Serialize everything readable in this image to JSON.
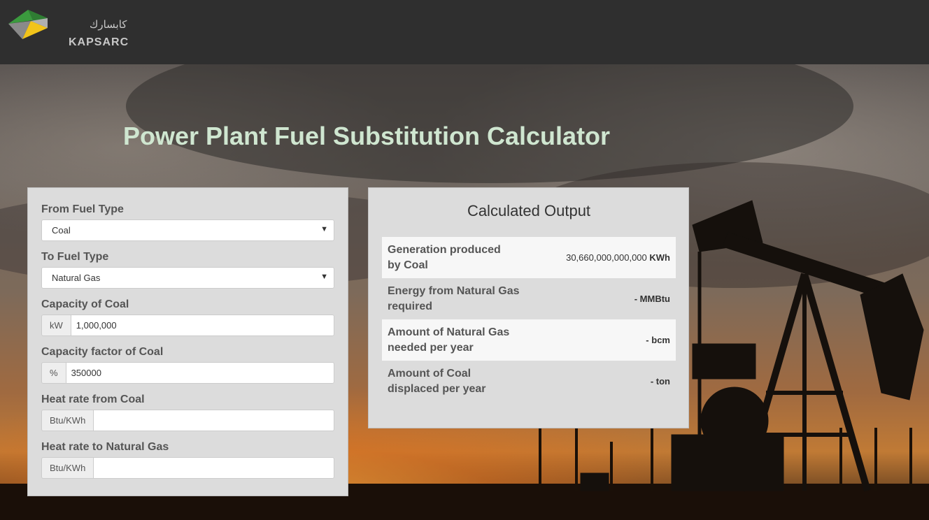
{
  "header": {
    "logo_ar": "كابسارك",
    "logo_en": "KAPSARC"
  },
  "page": {
    "title": "Power Plant Fuel Substitution Calculator"
  },
  "inputs": {
    "from_fuel": {
      "label": "From Fuel Type",
      "value": "Coal"
    },
    "to_fuel": {
      "label": "To Fuel Type",
      "value": "Natural Gas"
    },
    "capacity": {
      "label": "Capacity of Coal",
      "unit": "kW",
      "value": "1,000,000"
    },
    "capacity_factor": {
      "label": "Capacity factor of Coal",
      "unit": "%",
      "value": "350000"
    },
    "heat_rate_from": {
      "label": "Heat rate from Coal",
      "unit": "Btu/KWh",
      "value": ""
    },
    "heat_rate_to": {
      "label": "Heat rate to Natural Gas",
      "unit": "Btu/KWh",
      "value": ""
    }
  },
  "output": {
    "title": "Calculated Output",
    "rows": [
      {
        "label_line1": "Generation produced",
        "label_line2": "by Coal",
        "value": "30,660,000,000,000",
        "unit": "KWh"
      },
      {
        "label_line1": "Energy from Natural Gas",
        "label_line2": "required",
        "value": "-",
        "unit": "MMBtu"
      },
      {
        "label_line1": "Amount of Natural Gas",
        "label_line2": "needed per year",
        "value": "-",
        "unit": "bcm"
      },
      {
        "label_line1": "Amount of Coal",
        "label_line2": "displaced per year",
        "value": "-",
        "unit": "ton"
      }
    ]
  },
  "colors": {
    "topbar": "#2f2f2f",
    "title": "#cfe6d0",
    "panel": "#dcdcdc",
    "logo_green": "#3b9a3e",
    "logo_yellow": "#f2c41a",
    "logo_gray": "#8a8a8a"
  }
}
